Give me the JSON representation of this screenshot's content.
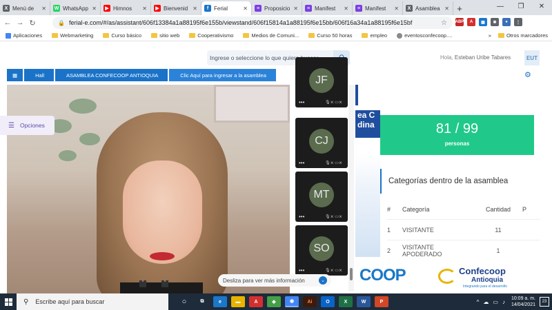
{
  "browser": {
    "tabs": [
      {
        "title": "Menú de",
        "color": "#5f6368",
        "glyph": "X"
      },
      {
        "title": "WhatsApp",
        "color": "#25d366",
        "glyph": "W"
      },
      {
        "title": "Himnos",
        "color": "#ff0000",
        "glyph": "▶"
      },
      {
        "title": "Bienvenid",
        "color": "#ff0000",
        "glyph": "▶"
      },
      {
        "title": "Ferial",
        "color": "#1a73c8",
        "glyph": "f",
        "active": true
      },
      {
        "title": "Proposicio",
        "color": "#7b3fe4",
        "glyph": "≡"
      },
      {
        "title": "Manifest",
        "color": "#7b3fe4",
        "glyph": "≡"
      },
      {
        "title": "Manifest",
        "color": "#7b3fe4",
        "glyph": "≡"
      },
      {
        "title": "Asamblea",
        "color": "#5f6368",
        "glyph": "X"
      }
    ],
    "new_tab": "+",
    "url": "ferial-e.com/#/as/assistant/606f13384a1a88195f6e155b/viewstand/606f15814a1a88195f6e15bb/606f16a34a1a88195f6e15bf",
    "bookmarks": [
      "Aplicaciones",
      "Webmarketing",
      "Curso básico",
      "sitio web",
      "Cooperativismo",
      "Medios de Comuni...",
      "Curso 50 horas",
      "empleo",
      "eventosconfecoop...."
    ],
    "other_bookmarks": "Otros marcadores"
  },
  "header": {
    "search_placeholder": "Ingrese o seleccione lo que quiere buscar",
    "greeting_prefix": "Hola,",
    "user_name": "Esteban Uribe Tabares",
    "user_initials": "EUT"
  },
  "breadcrumbs": {
    "hall": "Hall",
    "assembly": "ASAMBLEA CONFECOOP ANTIOQUIA",
    "enter": "Clic Aquí para ingresar a la asamblea"
  },
  "sidebar": {
    "options_label": "Opciones"
  },
  "participants": [
    "JF",
    "CJ",
    "MT",
    "SO"
  ],
  "counter": {
    "value": "81 / 99",
    "label": "personas"
  },
  "categories": {
    "heading": "Categorías dentro de la asamblea",
    "columns": [
      "#",
      "Categoría",
      "Cantidad",
      "P"
    ],
    "rows": [
      {
        "n": "1",
        "category": "VISITANTE",
        "count": "11"
      },
      {
        "n": "2",
        "category": "VISITANTE APODERADO",
        "count": "1"
      }
    ]
  },
  "logos": {
    "coop": "COOP",
    "confecoop": "Confecoop",
    "region": "Antioquia",
    "tagline": "Integrando para el desarrollo"
  },
  "scroll_hint": "Desliza para ver más información",
  "taskbar": {
    "search_placeholder": "Escribe aquí para buscar",
    "time": "10:09 a. m.",
    "date": "14/04/2021",
    "notifications": "23"
  }
}
